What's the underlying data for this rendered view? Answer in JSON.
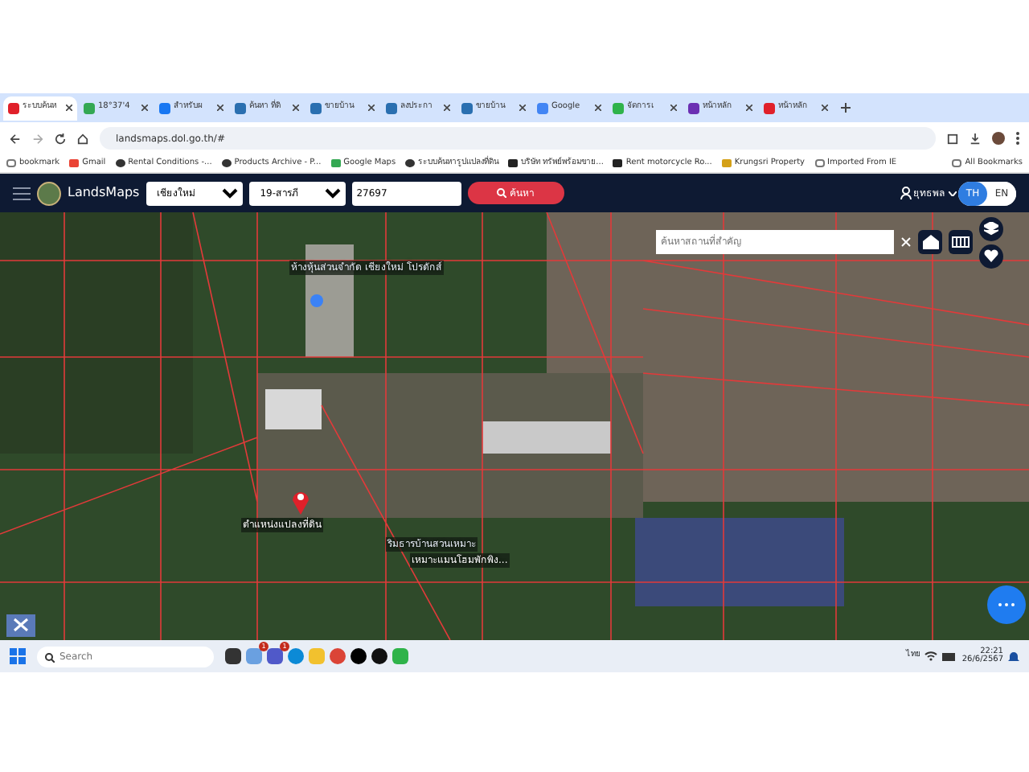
{
  "browser": {
    "tabs": [
      {
        "title": "ระบบค้นห",
        "selected": true,
        "kind": "pin"
      },
      {
        "title": "18°37'4",
        "selected": false,
        "kind": "map"
      },
      {
        "title": "สำหรับผ",
        "selected": false,
        "kind": "facebook"
      },
      {
        "title": "ค้นหา ที่ดิ",
        "selected": false,
        "kind": "house"
      },
      {
        "title": "ขายบ้าน",
        "selected": false,
        "kind": "house"
      },
      {
        "title": "ลงประกา",
        "selected": false,
        "kind": "house"
      },
      {
        "title": "ขายบ้าน",
        "selected": false,
        "kind": "house"
      },
      {
        "title": "Google",
        "selected": false,
        "kind": "google"
      },
      {
        "title": "จัดการเ",
        "selected": false,
        "kind": "b"
      },
      {
        "title": "หน้าหลัก",
        "selected": false,
        "kind": "purple"
      },
      {
        "title": "หน้าหลัก",
        "selected": false,
        "kind": "red"
      }
    ],
    "address": "landsmaps.dol.go.th/#",
    "bookmarks": [
      {
        "label": "bookmark",
        "kind": "folder"
      },
      {
        "label": "Gmail",
        "kind": "gmail"
      },
      {
        "label": "Rental Conditions -...",
        "kind": "globe"
      },
      {
        "label": "Products Archive - P...",
        "kind": "globe"
      },
      {
        "label": "Google Maps",
        "kind": "map"
      },
      {
        "label": "ระบบค้นหารูปแปลงที่ดิน",
        "kind": "globe"
      },
      {
        "label": "บริษัท ทรัพย์พร้อมขาย...",
        "kind": "site"
      },
      {
        "label": "Rent motorcycle Ro...",
        "kind": "site"
      },
      {
        "label": "Krungsri Property",
        "kind": "yellow"
      },
      {
        "label": "Imported From IE",
        "kind": "folder"
      },
      {
        "label": "All Bookmarks",
        "kind": "folder"
      }
    ]
  },
  "app": {
    "brand": "LandsMaps",
    "province": "เชียงใหม่",
    "district": "19-สารภี",
    "parcel_number": "27697",
    "search_button": "ค้นหา",
    "user": "ยุทธพล",
    "languages": [
      {
        "label": "TH",
        "selected": true
      },
      {
        "label": "EN",
        "selected": false
      }
    ]
  },
  "map": {
    "place_search": {
      "placeholder": "ค้นหาสถานที่สำคัญ"
    },
    "labels": [
      {
        "text": "ห้างหุ้นส่วนจำกัด เชียงใหม่ โปรดักส์",
        "kind": "place"
      },
      {
        "text": "ตำแหน่งแปลงที่ดิน",
        "kind": "pin"
      },
      {
        "text": "ริมธารบ้านสวนเหมาะ",
        "kind": "place"
      },
      {
        "text": "เหมาะแมนโฮมพักพิง...",
        "kind": "plain"
      }
    ]
  },
  "taskbar": {
    "search_placeholder": "Search",
    "apps": [
      {
        "kind": "files-dark"
      },
      {
        "kind": "weather",
        "badge": "1"
      },
      {
        "kind": "teams",
        "badge": "1"
      },
      {
        "kind": "edge"
      },
      {
        "kind": "folder"
      },
      {
        "kind": "chrome"
      },
      {
        "kind": "x"
      },
      {
        "kind": "tiktok"
      },
      {
        "kind": "chat"
      }
    ],
    "language": "ไทย",
    "time": "22:21",
    "date": "26/6/2567"
  }
}
